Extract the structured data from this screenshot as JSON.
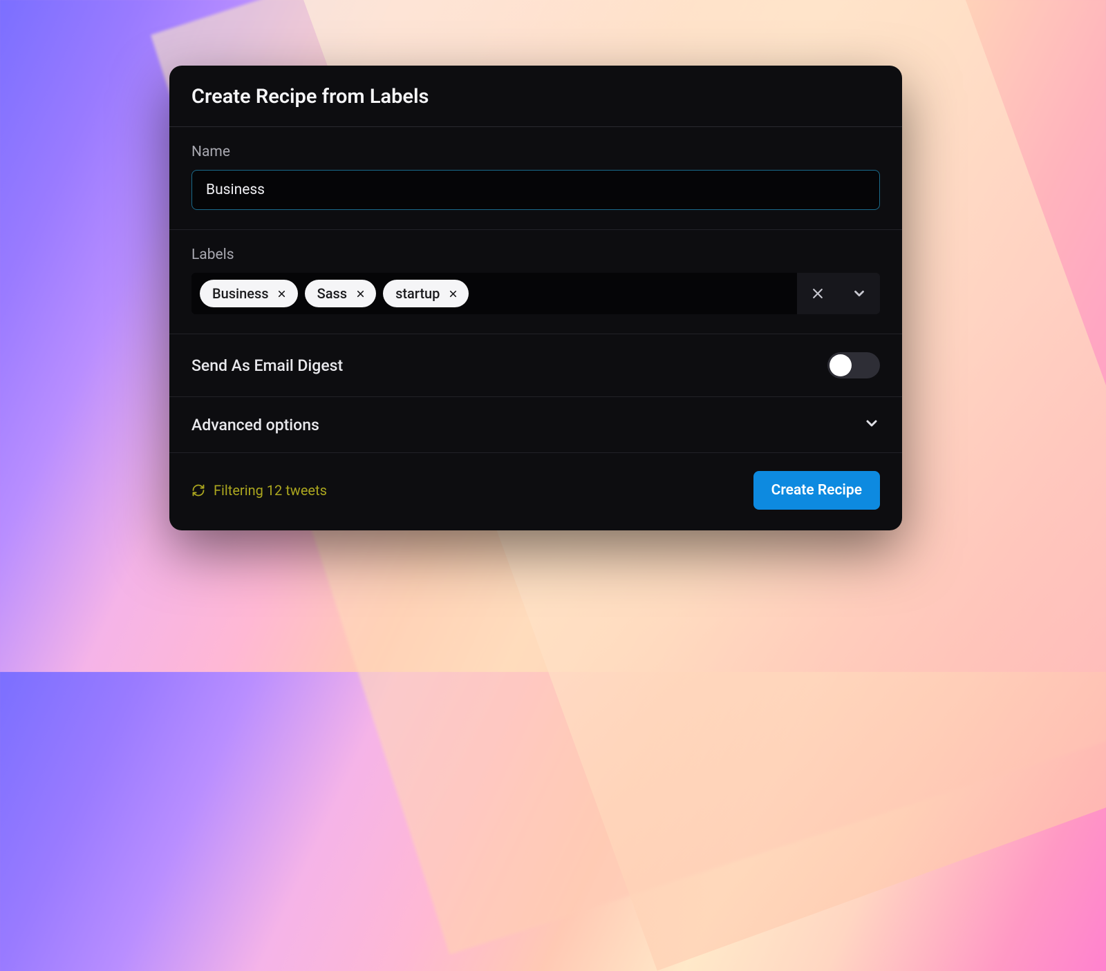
{
  "modal": {
    "title": "Create Recipe from Labels",
    "nameField": {
      "label": "Name",
      "value": "Business"
    },
    "labelsField": {
      "label": "Labels",
      "tags": [
        "Business",
        "Sass",
        "startup"
      ]
    },
    "emailDigest": {
      "label": "Send As Email Digest",
      "enabled": false
    },
    "advanced": {
      "label": "Advanced options"
    },
    "footer": {
      "status": "Filtering 12 tweets",
      "submitLabel": "Create Recipe"
    }
  },
  "colors": {
    "accent": "#0d8ae0",
    "statusText": "#aba61f",
    "modalBg": "#0d0d10"
  }
}
